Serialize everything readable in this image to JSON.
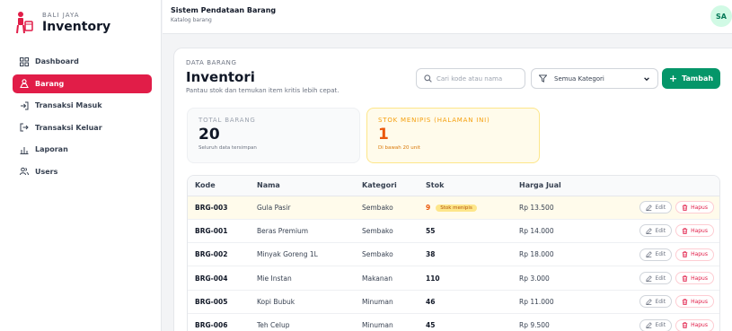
{
  "brand": {
    "subtitle": "BALI JAYA",
    "title": "Inventory"
  },
  "nav": [
    {
      "label": "Dashboard",
      "icon": "grid-icon"
    },
    {
      "label": "Barang",
      "icon": "box-icon",
      "active": true
    },
    {
      "label": "Transaksi Masuk",
      "icon": "login-arrow-icon"
    },
    {
      "label": "Transaksi Keluar",
      "icon": "logout-arrow-icon"
    },
    {
      "label": "Laporan",
      "icon": "bar-chart-icon"
    },
    {
      "label": "Users",
      "icon": "users-icon"
    }
  ],
  "header": {
    "title": "Sistem Pendataan Barang",
    "subtitle": "Katalog barang",
    "avatar": "SA"
  },
  "page": {
    "section": "DATA BARANG",
    "title": "Inventori",
    "description": "Pantau stok dan temukan item kritis lebih cepat."
  },
  "search": {
    "placeholder": "Cari kode atau nama",
    "value": ""
  },
  "filter": {
    "selected": "Semua Kategori"
  },
  "add_button": {
    "label": "Tambah"
  },
  "stats": {
    "total": {
      "label": "TOTAL BARANG",
      "value": "20",
      "note": "Seluruh data tersimpan"
    },
    "low": {
      "label": "STOK MENIPIS (HALAMAN INI)",
      "value": "1",
      "note": "Di bawah 20 unit"
    }
  },
  "table": {
    "columns": [
      "Kode",
      "Nama",
      "Kategori",
      "Stok",
      "Harga Jual"
    ],
    "low_badge": "Stok menipis",
    "edit_label": "Edit",
    "delete_label": "Hapus",
    "rows": [
      {
        "kode": "BRG-003",
        "nama": "Gula Pasir",
        "kategori": "Sembako",
        "stok": "9",
        "harga": "Rp 13.500",
        "low": true
      },
      {
        "kode": "BRG-001",
        "nama": "Beras Premium",
        "kategori": "Sembako",
        "stok": "55",
        "harga": "Rp 14.000"
      },
      {
        "kode": "BRG-002",
        "nama": "Minyak Goreng 1L",
        "kategori": "Sembako",
        "stok": "38",
        "harga": "Rp 18.000"
      },
      {
        "kode": "BRG-004",
        "nama": "Mie Instan",
        "kategori": "Makanan",
        "stok": "110",
        "harga": "Rp 3.000"
      },
      {
        "kode": "BRG-005",
        "nama": "Kopi Bubuk",
        "kategori": "Minuman",
        "stok": "46",
        "harga": "Rp 11.000"
      },
      {
        "kode": "BRG-006",
        "nama": "Teh Celup",
        "kategori": "Minuman",
        "stok": "45",
        "harga": "Rp 9.500"
      }
    ]
  },
  "colors": {
    "accent": "#e11d48",
    "primary": "#059669",
    "warning": "#f59e0b"
  }
}
